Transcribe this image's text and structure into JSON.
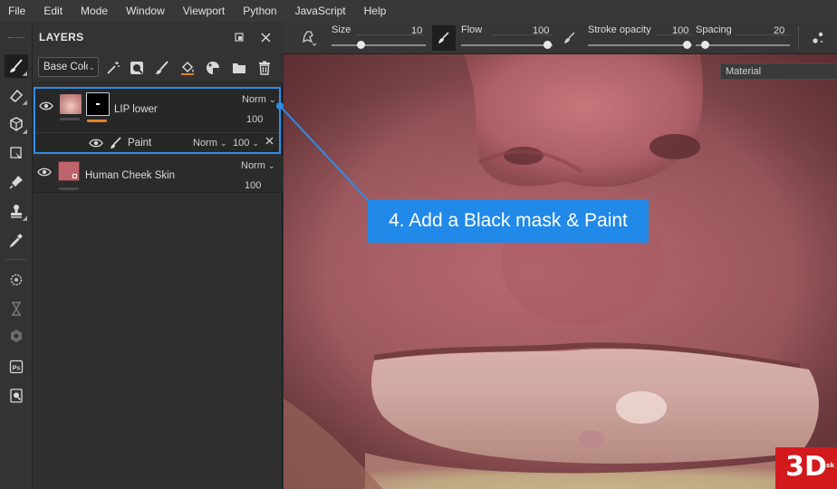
{
  "menubar": {
    "items": [
      "File",
      "Edit",
      "Mode",
      "Window",
      "Viewport",
      "Python",
      "JavaScript",
      "Help"
    ]
  },
  "toolbar": {
    "tools": [
      "brush-icon",
      "eraser-icon",
      "cube-icon",
      "select-icon",
      "pin-icon",
      "stamp-icon",
      "eyedropper-icon",
      "gear-icon",
      "hourglass-icon",
      "hexagon-icon",
      "photoshop-icon",
      "magnifier-icon"
    ],
    "active": "brush-icon"
  },
  "layers_panel": {
    "title": "LAYERS",
    "blend_select": "Base Colc",
    "layers": [
      {
        "name": "LIP lower",
        "blend": "Norm",
        "opacity": "100",
        "selected": true,
        "sublayer": {
          "name": "Paint",
          "blend": "Norm",
          "opacity": "100"
        }
      },
      {
        "name": "Human Cheek Skin",
        "blend": "Norm",
        "opacity": "100",
        "selected": false
      }
    ]
  },
  "options_bar": {
    "size": {
      "label": "Size",
      "value": "10"
    },
    "flow": {
      "label": "Flow",
      "value": "100"
    },
    "stroke_opacity": {
      "label": "Stroke opacity",
      "value": "100"
    },
    "spacing": {
      "label": "Spacing",
      "value": "20"
    }
  },
  "viewport": {
    "material_label": "Material"
  },
  "callout": {
    "text": "4. Add a Black mask & Paint"
  },
  "logo": {
    "text": "3D",
    "suffix": ".sk"
  },
  "colors": {
    "accent": "#2189e8",
    "selection_border": "#2f8ce8",
    "layer_underline": "#e0822a",
    "logo_red": "#d2191b"
  }
}
